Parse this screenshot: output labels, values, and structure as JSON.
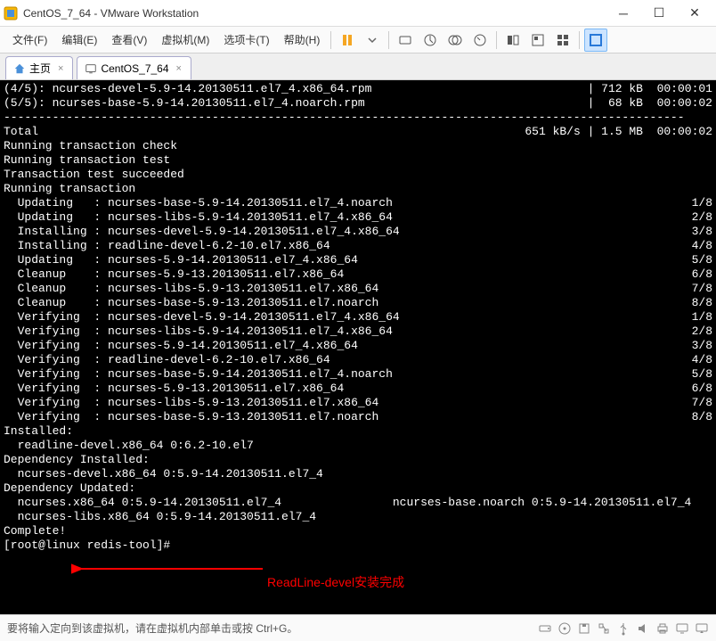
{
  "window": {
    "title": "CentOS_7_64 - VMware Workstation"
  },
  "menu": {
    "file": "文件(F)",
    "edit": "编辑(E)",
    "view": "查看(V)",
    "vm": "虚拟机(M)",
    "tabs": "选项卡(T)",
    "help": "帮助(H)"
  },
  "tabs": {
    "home": "主页",
    "vm": "CentOS_7_64"
  },
  "terminal": {
    "lines": [
      {
        "left": "(4/5): ncurses-devel-5.9-14.20130511.el7_4.x86_64.rpm",
        "right": "| 712 kB  00:00:01"
      },
      {
        "left": "(5/5): ncurses-base-5.9-14.20130511.el7_4.noarch.rpm",
        "right": "|  68 kB  00:00:02"
      },
      {
        "left": "--------------------------------------------------------------------------------------------------",
        "right": ""
      },
      {
        "left": "Total",
        "right": "651 kB/s | 1.5 MB  00:00:02"
      },
      {
        "left": "Running transaction check",
        "right": ""
      },
      {
        "left": "Running transaction test",
        "right": ""
      },
      {
        "left": "Transaction test succeeded",
        "right": ""
      },
      {
        "left": "Running transaction",
        "right": ""
      },
      {
        "left": "  Updating   : ncurses-base-5.9-14.20130511.el7_4.noarch",
        "right": "1/8"
      },
      {
        "left": "  Updating   : ncurses-libs-5.9-14.20130511.el7_4.x86_64",
        "right": "2/8"
      },
      {
        "left": "  Installing : ncurses-devel-5.9-14.20130511.el7_4.x86_64",
        "right": "3/8"
      },
      {
        "left": "  Installing : readline-devel-6.2-10.el7.x86_64",
        "right": "4/8"
      },
      {
        "left": "  Updating   : ncurses-5.9-14.20130511.el7_4.x86_64",
        "right": "5/8"
      },
      {
        "left": "  Cleanup    : ncurses-5.9-13.20130511.el7.x86_64",
        "right": "6/8"
      },
      {
        "left": "  Cleanup    : ncurses-libs-5.9-13.20130511.el7.x86_64",
        "right": "7/8"
      },
      {
        "left": "  Cleanup    : ncurses-base-5.9-13.20130511.el7.noarch",
        "right": "8/8"
      },
      {
        "left": "  Verifying  : ncurses-devel-5.9-14.20130511.el7_4.x86_64",
        "right": "1/8"
      },
      {
        "left": "  Verifying  : ncurses-libs-5.9-14.20130511.el7_4.x86_64",
        "right": "2/8"
      },
      {
        "left": "  Verifying  : ncurses-5.9-14.20130511.el7_4.x86_64",
        "right": "3/8"
      },
      {
        "left": "  Verifying  : readline-devel-6.2-10.el7.x86_64",
        "right": "4/8"
      },
      {
        "left": "  Verifying  : ncurses-base-5.9-14.20130511.el7_4.noarch",
        "right": "5/8"
      },
      {
        "left": "  Verifying  : ncurses-5.9-13.20130511.el7.x86_64",
        "right": "6/8"
      },
      {
        "left": "  Verifying  : ncurses-libs-5.9-13.20130511.el7.x86_64",
        "right": "7/8"
      },
      {
        "left": "  Verifying  : ncurses-base-5.9-13.20130511.el7.noarch",
        "right": "8/8"
      },
      {
        "left": "",
        "right": ""
      },
      {
        "left": "Installed:",
        "right": ""
      },
      {
        "left": "  readline-devel.x86_64 0:6.2-10.el7",
        "right": ""
      },
      {
        "left": "",
        "right": ""
      },
      {
        "left": "Dependency Installed:",
        "right": ""
      },
      {
        "left": "  ncurses-devel.x86_64 0:5.9-14.20130511.el7_4",
        "right": ""
      },
      {
        "left": "",
        "right": ""
      },
      {
        "left": "Dependency Updated:",
        "right": ""
      },
      {
        "left": "  ncurses.x86_64 0:5.9-14.20130511.el7_4                ncurses-base.noarch 0:5.9-14.20130511.el7_4",
        "right": ""
      },
      {
        "left": "  ncurses-libs.x86_64 0:5.9-14.20130511.el7_4",
        "right": ""
      },
      {
        "left": "",
        "right": ""
      },
      {
        "left": "Complete!",
        "right": ""
      },
      {
        "left": "[root@linux redis-tool]# ",
        "right": ""
      }
    ]
  },
  "annotation": {
    "text": "ReadLine-devel安装完成"
  },
  "statusbar": {
    "text": "要将输入定向到该虚拟机，请在虚拟机内部单击或按 Ctrl+G。"
  }
}
